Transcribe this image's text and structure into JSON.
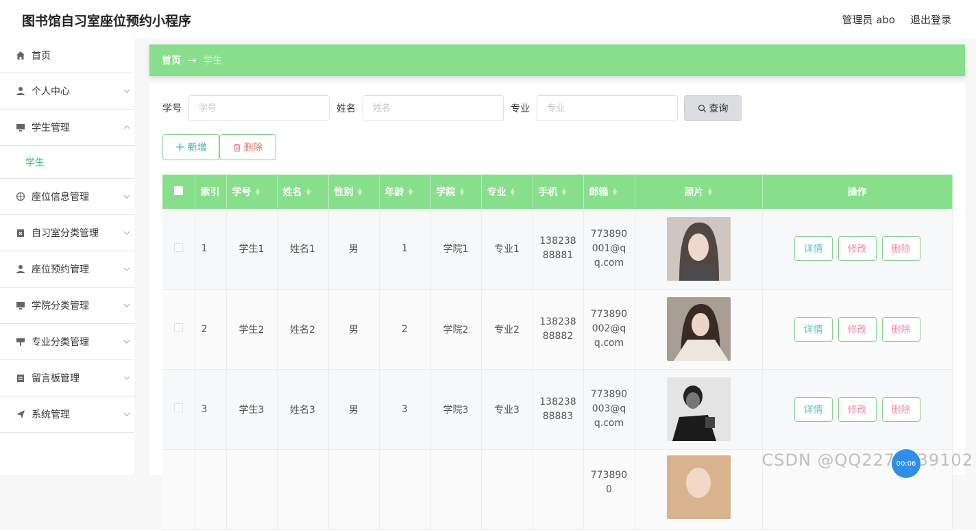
{
  "app": {
    "title": "图书馆自习室座位预约小程序",
    "user": "管理员 abo",
    "logout": "退出登录"
  },
  "sidebar": {
    "items": [
      {
        "label": "首页",
        "icon": "home-icon"
      },
      {
        "label": "个人中心",
        "icon": "user-icon"
      },
      {
        "label": "学生管理",
        "icon": "monitor-icon"
      },
      {
        "label": "座位信息管理",
        "icon": "compass-icon"
      },
      {
        "label": "自习室分类管理",
        "icon": "clipboard-icon"
      },
      {
        "label": "座位预约管理",
        "icon": "user-icon"
      },
      {
        "label": "学院分类管理",
        "icon": "monitor-icon"
      },
      {
        "label": "专业分类管理",
        "icon": "signboard-icon"
      },
      {
        "label": "留言板管理",
        "icon": "clipboard-icon"
      },
      {
        "label": "系统管理",
        "icon": "send-icon"
      }
    ],
    "sub_active": "学生"
  },
  "breadcrumb": {
    "home": "首页",
    "arrow": "→",
    "current": "学生"
  },
  "search": {
    "xuehao_label": "学号",
    "xuehao_placeholder": "学号",
    "xingming_label": "姓名",
    "xingming_placeholder": "姓名",
    "zhuanye_label": "专业",
    "zhuanye_placeholder": "专业",
    "query": "查询"
  },
  "actions": {
    "add": "新增",
    "delete": "删除"
  },
  "table": {
    "headers": [
      "索引",
      "学号",
      "姓名",
      "性别",
      "年龄",
      "学院",
      "专业",
      "手机",
      "邮箱",
      "照片",
      "操作"
    ],
    "rows": [
      {
        "index": "1",
        "xuehao": "学生1",
        "xingming": "姓名1",
        "xingbie": "男",
        "nianling": "1",
        "xueyuan": "学院1",
        "zhuanye": "专业1",
        "phone": "13823888881",
        "email": "773890001@qq.com"
      },
      {
        "index": "2",
        "xuehao": "学生2",
        "xingming": "姓名2",
        "xingbie": "男",
        "nianling": "2",
        "xueyuan": "学院2",
        "zhuanye": "专业2",
        "phone": "13823888882",
        "email": "773890002@qq.com"
      },
      {
        "index": "3",
        "xuehao": "学生3",
        "xingming": "姓名3",
        "xingbie": "男",
        "nianling": "3",
        "xueyuan": "学院3",
        "zhuanye": "专业3",
        "phone": "13823888883",
        "email": "773890003@qq.com"
      }
    ],
    "partial_row_email_fragment": "7738900",
    "ops": {
      "detail": "详情",
      "edit": "修改",
      "delete": "删除"
    }
  },
  "overlay": {
    "watermark": "CSDN @QQ2279239102",
    "timer": "00:06"
  },
  "colors": {
    "accent_green": "#87de8b",
    "active_text": "#2fc06e",
    "detail_text": "#5cc3c4",
    "edit_delete_text": "#f08fa7"
  }
}
